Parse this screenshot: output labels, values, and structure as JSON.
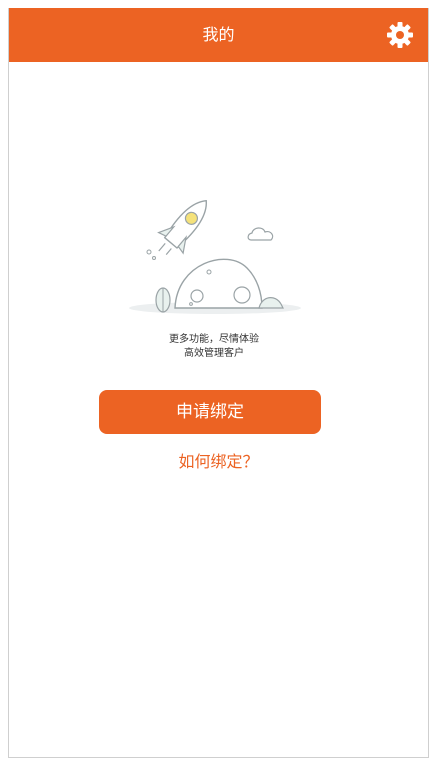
{
  "header": {
    "title": "我的",
    "settings_icon": "gear-icon",
    "background_color": "#EC6323"
  },
  "empty_state": {
    "illustration": "rocket-moon-illustration",
    "line1": "更多功能，尽情体验",
    "line2": "高效管理客户"
  },
  "actions": {
    "apply_bind_label": "申请绑定",
    "how_to_bind_label": "如何绑定？"
  },
  "colors": {
    "accent": "#EC6323",
    "illustration_stroke": "#9aa3a6",
    "illustration_fill_light": "#e8f1ee"
  }
}
